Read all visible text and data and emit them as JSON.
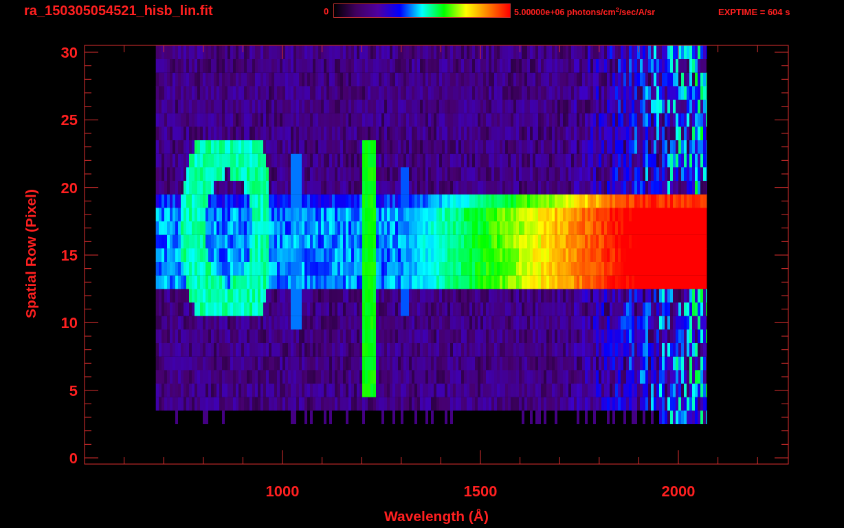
{
  "title": "ra_150305054521_hisb_lin.fit",
  "colorbar": {
    "min_label": "0",
    "max_label": "5.00000e+06 photons/cm$^{2}$/sec/A/sr"
  },
  "exptime": "EXPTIME = 604 s",
  "plot": {
    "xlabel": "Wavelength (Å)",
    "ylabel": "Spatial Row (Pixel)",
    "xticks": [
      "1000",
      "1500",
      "2000"
    ],
    "yticks": [
      "30",
      "25",
      "20",
      "15",
      "10",
      "5",
      "0"
    ]
  }
}
